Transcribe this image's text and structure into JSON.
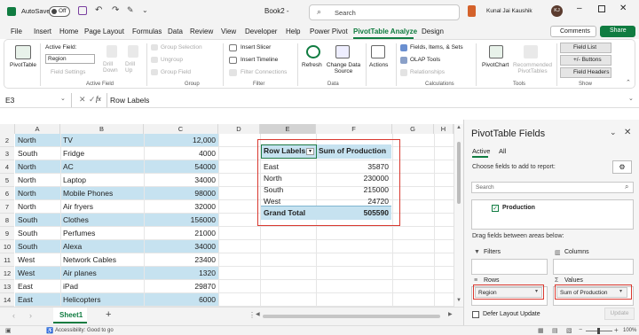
{
  "titlebar": {
    "autosave_label": "AutoSave",
    "autosave_state": "Off",
    "doc_title": "Book2 -",
    "search_placeholder": "Search",
    "user_name": "Kunal Jai Kaushik",
    "user_initials": "KJ"
  },
  "menu": {
    "items": [
      "File",
      "Insert",
      "Home",
      "Page Layout",
      "Formulas",
      "Data",
      "Review",
      "View",
      "Developer",
      "Help",
      "Power Pivot",
      "PivotTable Analyze",
      "Design"
    ],
    "comments": "Comments",
    "share": "Share"
  },
  "ribbon": {
    "pivottable": "PivotTable",
    "active_field_label": "Active Field:",
    "active_field_value": "Region",
    "field_settings": "Field Settings",
    "drill_down": "Drill Down",
    "drill_up": "Drill Up",
    "group_selection": "Group Selection",
    "ungroup": "Ungroup",
    "group_field": "Group Field",
    "insert_slicer": "Insert Slicer",
    "insert_timeline": "Insert Timeline",
    "filter_connections": "Filter Connections",
    "refresh": "Refresh",
    "change_data_source": "Change Data Source",
    "actions": "Actions",
    "fields_items_sets": "Fields, Items, & Sets",
    "olap_tools": "OLAP Tools",
    "relationships": "Relationships",
    "pivotchart": "PivotChart",
    "recommended_pivottables": "Recommended PivotTables",
    "field_list": "Field List",
    "buttons": "+/- Buttons",
    "field_headers": "Field Headers",
    "groups": {
      "active_field": "Active Field",
      "group": "Group",
      "filter": "Filter",
      "data": "Data",
      "calculations": "Calculations",
      "tools": "Tools",
      "show": "Show"
    }
  },
  "formula": {
    "name_box": "E3",
    "fx": "fx",
    "content": "Row Labels"
  },
  "columns": [
    "A",
    "B",
    "C",
    "D",
    "E",
    "F",
    "G",
    "H"
  ],
  "rows": [
    {
      "n": "2",
      "a": "North",
      "b": "TV",
      "c": "12,000",
      "band": true
    },
    {
      "n": "3",
      "a": "South",
      "b": "Fridge",
      "c": "4000",
      "band": false
    },
    {
      "n": "4",
      "a": "North",
      "b": "AC",
      "c": "54000",
      "band": true
    },
    {
      "n": "5",
      "a": "North",
      "b": "Laptop",
      "c": "34000",
      "band": false
    },
    {
      "n": "6",
      "a": "North",
      "b": "Mobile Phones",
      "c": "98000",
      "band": true
    },
    {
      "n": "7",
      "a": "North",
      "b": "Air fryers",
      "c": "32000",
      "band": false
    },
    {
      "n": "8",
      "a": "South",
      "b": "Clothes",
      "c": "156000",
      "band": true
    },
    {
      "n": "9",
      "a": "South",
      "b": "Perfumes",
      "c": "21000",
      "band": false
    },
    {
      "n": "10",
      "a": "South",
      "b": "Alexa",
      "c": "34000",
      "band": true
    },
    {
      "n": "11",
      "a": "West",
      "b": "Network Cables",
      "c": "23400",
      "band": false
    },
    {
      "n": "12",
      "a": "West",
      "b": "Air planes",
      "c": "1320",
      "band": true
    },
    {
      "n": "13",
      "a": "East",
      "b": "iPad",
      "c": "29870",
      "band": false
    },
    {
      "n": "14",
      "a": "East",
      "b": "Helicopters",
      "c": "6000",
      "band": true
    },
    {
      "n": "15",
      "a": "",
      "b": "",
      "c": "",
      "band": false
    },
    {
      "n": "16",
      "a": "",
      "b": "",
      "c": "",
      "band": false
    }
  ],
  "pivot": {
    "header_label": "Row Labels",
    "header_value": "Sum of Production",
    "rows": [
      {
        "label": "East",
        "value": "35870"
      },
      {
        "label": "North",
        "value": "230000"
      },
      {
        "label": "South",
        "value": "215000"
      },
      {
        "label": "West",
        "value": "24720"
      }
    ],
    "total_label": "Grand Total",
    "total_value": "505590"
  },
  "sheet_tab": "Sheet1",
  "pane": {
    "title": "PivotTable Fields",
    "tab_active": "Active",
    "tab_all": "All",
    "choose_text": "Choose fields to add to report:",
    "search_placeholder": "Search",
    "field_name": "Production",
    "drag_text": "Drag fields between areas below:",
    "filters_label": "Filters",
    "columns_label": "Columns",
    "rows_label": "Rows",
    "values_label": "Values",
    "rows_item": "Region",
    "values_item": "Sum of Production",
    "defer_label": "Defer Layout Update",
    "update_button": "Update"
  },
  "status": {
    "accessibility": "Accessibility: Good to go",
    "zoom": "100%"
  },
  "colors": {
    "accent": "#107c41",
    "band": "#c6e2f0",
    "highlight_border": "#d9382f"
  }
}
